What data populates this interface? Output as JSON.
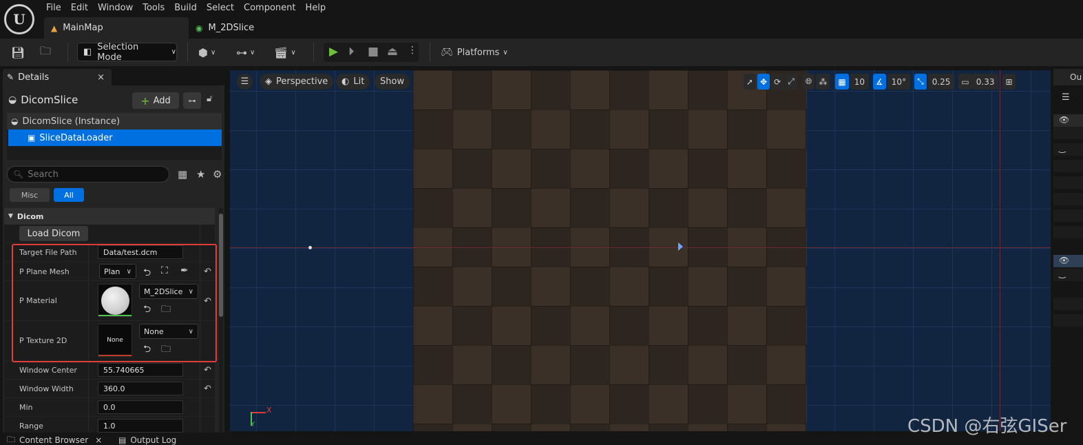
{
  "menu": [
    "File",
    "Edit",
    "Window",
    "Tools",
    "Build",
    "Select",
    "Component",
    "Help"
  ],
  "tabs": [
    {
      "label": "MainMap",
      "active": true
    },
    {
      "label": "M_2DSlice",
      "active": false
    }
  ],
  "toolbar": {
    "selection_mode": "Selection Mode",
    "platforms": "Platforms"
  },
  "details": {
    "tab_label": "Details",
    "close_glyph": "×",
    "actor_name": "DicomSlice",
    "add_label": "Add",
    "components": {
      "instance": "DicomSlice (Instance)",
      "selected": "SliceDataLoader"
    },
    "search_placeholder": "Search",
    "filters": {
      "misc": "Misc",
      "all": "All"
    },
    "category": "Dicom",
    "load_button": "Load Dicom",
    "properties": {
      "target_file_path": {
        "label": "Target File Path",
        "value": "Data/test.dcm"
      },
      "plane_mesh": {
        "label": "P Plane Mesh",
        "value": "Plan"
      },
      "material": {
        "label": "P Material",
        "value": "M_2DSlice"
      },
      "texture": {
        "label": "P Texture 2D",
        "value": "None",
        "thumb_text": "None"
      },
      "window_center": {
        "label": "Window Center",
        "value": "55.740665"
      },
      "window_width": {
        "label": "Window Width",
        "value": "360.0"
      },
      "min": {
        "label": "Min",
        "value": "0.0"
      },
      "range": {
        "label": "Range",
        "value": "1.0"
      }
    }
  },
  "viewport": {
    "perspective": "Perspective",
    "lit": "Lit",
    "show": "Show",
    "grid_snap": "10",
    "rotation_snap": "10°",
    "scale_snap": "0.25",
    "camera_speed": "0.33",
    "gizmo_x": "X",
    "gizmo_y": "Y"
  },
  "outliner": {
    "tab_label": "Ou"
  },
  "bottom": {
    "content_browser": "Content Browser",
    "output_log": "Output Log"
  },
  "watermark": "CSDN @右弦GISer",
  "colors": {
    "accent_blue": "#0070e0",
    "highlight_red": "#e23b3b",
    "play_green": "#6fbf3c"
  }
}
